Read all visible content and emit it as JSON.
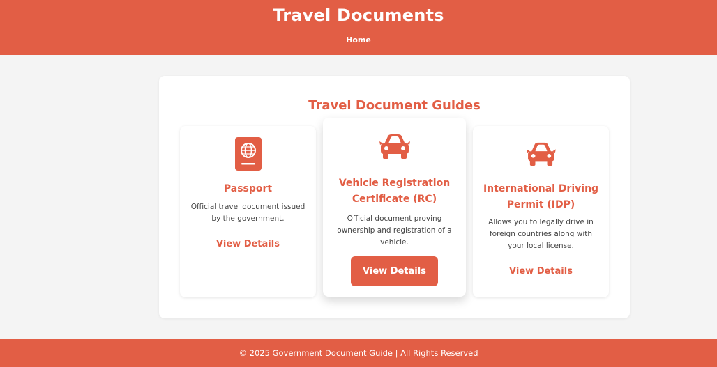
{
  "header": {
    "title": "Travel Documents",
    "nav_home": "Home"
  },
  "section": {
    "title": "Travel Document Guides"
  },
  "cards": [
    {
      "icon": "passport-icon",
      "title": "Passport",
      "description": "Official travel document issued by the government.",
      "link": "View Details"
    },
    {
      "icon": "car-icon",
      "title": "Vehicle Registration Certificate (RC)",
      "description": "Official document proving ownership and registration of a vehicle.",
      "link": "View Details"
    },
    {
      "icon": "car-icon",
      "title": "International Driving Permit (IDP)",
      "description": "Allows you to legally drive in foreign countries along with your local license.",
      "link": "View Details"
    }
  ],
  "footer": {
    "text": "© 2025 Government Document Guide | All Rights Reserved"
  },
  "colors": {
    "accent": "#e25e45",
    "background": "#f4f4f4",
    "card": "#ffffff"
  }
}
